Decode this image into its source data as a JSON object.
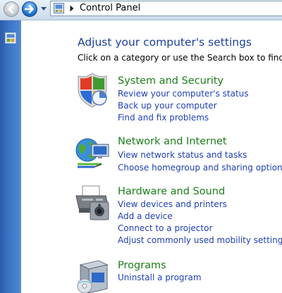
{
  "address_bar": {
    "crumb": "Control Panel"
  },
  "main": {
    "title": "Adjust your computer's settings",
    "subtitle": "Click on a category or use the Search box to find tasks o"
  },
  "categories": [
    {
      "title": "System and Security",
      "icon": "shield-icon",
      "links": [
        "Review your computer's status",
        "Back up your computer",
        "Find and fix problems"
      ]
    },
    {
      "title": "Network and Internet",
      "icon": "network-globe-icon",
      "links": [
        "View network status and tasks",
        "Choose homegroup and sharing options"
      ]
    },
    {
      "title": "Hardware and Sound",
      "icon": "printer-icon",
      "links": [
        "View devices and printers",
        "Add a device",
        "Connect to a projector",
        "Adjust commonly used mobility settings"
      ]
    },
    {
      "title": "Programs",
      "icon": "programs-box-icon",
      "links": [
        "Uninstall a program"
      ]
    }
  ],
  "colors": {
    "title_blue": "#1a3f9a",
    "category_green": "#1b7d1b",
    "link_blue": "#1f3fb8"
  }
}
